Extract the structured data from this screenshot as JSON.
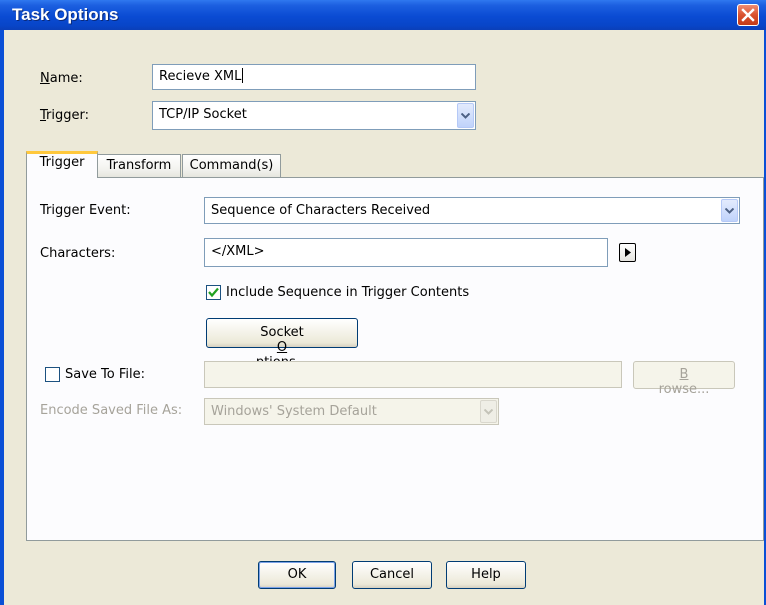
{
  "window": {
    "title": "Task Options"
  },
  "form": {
    "name_label": "Name:",
    "name_label_access": "N",
    "name_label_rest": "ame:",
    "name_value": "Recieve XML",
    "trigger_label_access": "T",
    "trigger_label_rest": "rigger:",
    "trigger_value": "TCP/IP Socket"
  },
  "tabs": [
    {
      "label": "Trigger",
      "active": true
    },
    {
      "label": "Transform",
      "active": false
    },
    {
      "label": "Command(s)",
      "active": false
    }
  ],
  "trigger_tab": {
    "trigger_event_label": "Trigger Event:",
    "trigger_event_value": "Sequence of Characters Received",
    "characters_label": "Characters:",
    "characters_value": "</XML>",
    "include_sequence_label": "Include Sequence in Trigger Contents",
    "include_sequence_checked": true,
    "socket_options_pre": "Socket ",
    "socket_options_access": "O",
    "socket_options_post": "ptions...",
    "save_to_file_label": "Save To File:",
    "save_to_file_checked": false,
    "save_to_file_value": "",
    "browse_access": "B",
    "browse_rest": "rowse...",
    "encode_label": "Encode Saved File As:",
    "encode_value": "Windows' System Default"
  },
  "footer": {
    "ok_label": "OK",
    "cancel_label": "Cancel",
    "help_label": "Help"
  },
  "colors": {
    "titlebar": "#0a4bd3",
    "dialog_bg": "#ece9d8",
    "tab_highlight": "#ffc83c",
    "checkmark": "#21a121"
  }
}
